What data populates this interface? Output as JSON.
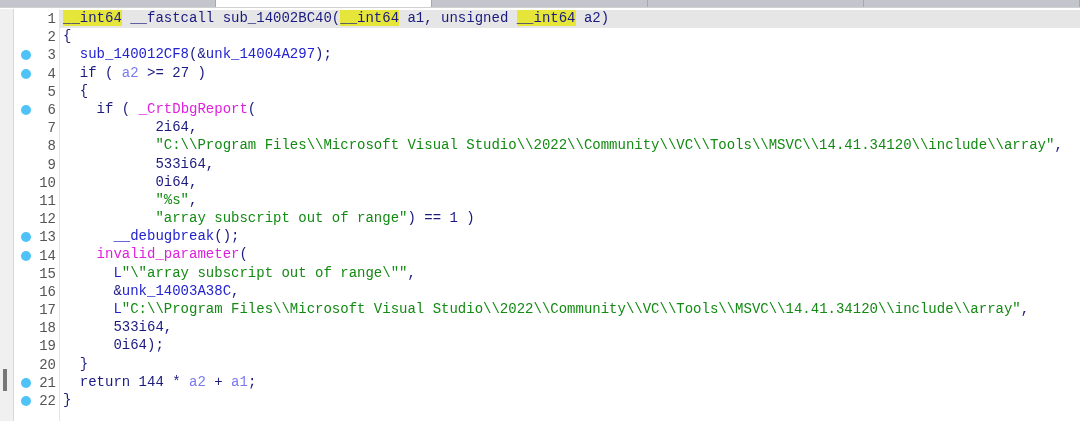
{
  "tabs": [
    {
      "selected": false
    },
    {
      "selected": true
    },
    {
      "selected": false
    },
    {
      "selected": false
    },
    {
      "selected": false
    }
  ],
  "lines": [
    {
      "number": "1",
      "breakpoint": false,
      "current": true,
      "tokens": [
        {
          "t": "__int64",
          "kind": "hl"
        },
        {
          "t": " __fastcall sub_14002BC40(",
          "kind": "plain"
        },
        {
          "t": "__int64",
          "kind": "hl"
        },
        {
          "t": " a1, unsigned ",
          "kind": "plain"
        },
        {
          "t": "__int64",
          "kind": "hl"
        },
        {
          "t": " a2)",
          "kind": "plain"
        }
      ]
    },
    {
      "number": "2",
      "breakpoint": false,
      "current": false,
      "tokens": [
        {
          "t": "{",
          "kind": "plain"
        }
      ]
    },
    {
      "number": "3",
      "breakpoint": true,
      "current": false,
      "tokens": [
        {
          "t": "  sub_140012CF8",
          "kind": "func"
        },
        {
          "t": "(&",
          "kind": "plain"
        },
        {
          "t": "unk_14004A297",
          "kind": "func"
        },
        {
          "t": ");",
          "kind": "plain"
        }
      ]
    },
    {
      "number": "4",
      "breakpoint": true,
      "current": false,
      "tokens": [
        {
          "t": "  if ( ",
          "kind": "plain"
        },
        {
          "t": "a2",
          "kind": "var"
        },
        {
          "t": " >= 27 )",
          "kind": "plain"
        }
      ]
    },
    {
      "number": "5",
      "breakpoint": false,
      "current": false,
      "tokens": [
        {
          "t": "  {",
          "kind": "plain"
        }
      ]
    },
    {
      "number": "6",
      "breakpoint": true,
      "current": false,
      "tokens": [
        {
          "t": "    if ( ",
          "kind": "plain"
        },
        {
          "t": "_CrtDbgReport",
          "kind": "lib"
        },
        {
          "t": "(",
          "kind": "plain"
        }
      ]
    },
    {
      "number": "7",
      "breakpoint": false,
      "current": false,
      "tokens": [
        {
          "t": "           2i64,",
          "kind": "plain"
        }
      ]
    },
    {
      "number": "8",
      "breakpoint": false,
      "current": false,
      "tokens": [
        {
          "t": "           \"C:\\\\Program Files\\\\Microsoft Visual Studio\\\\2022\\\\Community\\\\VC\\\\Tools\\\\MSVC\\\\14.41.34120\\\\include\\\\array\"",
          "kind": "str"
        },
        {
          "t": ",",
          "kind": "plain"
        }
      ]
    },
    {
      "number": "9",
      "breakpoint": false,
      "current": false,
      "tokens": [
        {
          "t": "           533i64,",
          "kind": "plain"
        }
      ]
    },
    {
      "number": "10",
      "breakpoint": false,
      "current": false,
      "tokens": [
        {
          "t": "           0i64,",
          "kind": "plain"
        }
      ]
    },
    {
      "number": "11",
      "breakpoint": false,
      "current": false,
      "tokens": [
        {
          "t": "           \"%s\"",
          "kind": "str"
        },
        {
          "t": ",",
          "kind": "plain"
        }
      ]
    },
    {
      "number": "12",
      "breakpoint": false,
      "current": false,
      "tokens": [
        {
          "t": "           \"array subscript out of range\"",
          "kind": "str"
        },
        {
          "t": ") == 1 )",
          "kind": "plain"
        }
      ]
    },
    {
      "number": "13",
      "breakpoint": true,
      "current": false,
      "tokens": [
        {
          "t": "      __debugbreak",
          "kind": "func"
        },
        {
          "t": "();",
          "kind": "plain"
        }
      ]
    },
    {
      "number": "14",
      "breakpoint": true,
      "current": false,
      "tokens": [
        {
          "t": "    invalid_parameter",
          "kind": "lib"
        },
        {
          "t": "(",
          "kind": "plain"
        }
      ]
    },
    {
      "number": "15",
      "breakpoint": false,
      "current": false,
      "tokens": [
        {
          "t": "      L",
          "kind": "func"
        },
        {
          "t": "\"\\\"array subscript out of range\\\"\"",
          "kind": "str"
        },
        {
          "t": ",",
          "kind": "plain"
        }
      ]
    },
    {
      "number": "16",
      "breakpoint": false,
      "current": false,
      "tokens": [
        {
          "t": "      &",
          "kind": "plain"
        },
        {
          "t": "unk_14003A38C",
          "kind": "func"
        },
        {
          "t": ",",
          "kind": "plain"
        }
      ]
    },
    {
      "number": "17",
      "breakpoint": false,
      "current": false,
      "tokens": [
        {
          "t": "      L",
          "kind": "func"
        },
        {
          "t": "\"C:\\\\Program Files\\\\Microsoft Visual Studio\\\\2022\\\\Community\\\\VC\\\\Tools\\\\MSVC\\\\14.41.34120\\\\include\\\\array\"",
          "kind": "str"
        },
        {
          "t": ",",
          "kind": "plain"
        }
      ]
    },
    {
      "number": "18",
      "breakpoint": false,
      "current": false,
      "tokens": [
        {
          "t": "      533i64,",
          "kind": "plain"
        }
      ]
    },
    {
      "number": "19",
      "breakpoint": false,
      "current": false,
      "tokens": [
        {
          "t": "      0i64);",
          "kind": "plain"
        }
      ]
    },
    {
      "number": "20",
      "breakpoint": false,
      "current": false,
      "tokens": [
        {
          "t": "  }",
          "kind": "plain"
        }
      ]
    },
    {
      "number": "21",
      "breakpoint": true,
      "current": false,
      "tokens": [
        {
          "t": "  return 144 * ",
          "kind": "plain"
        },
        {
          "t": "a2",
          "kind": "var"
        },
        {
          "t": " + ",
          "kind": "plain"
        },
        {
          "t": "a1",
          "kind": "var"
        },
        {
          "t": ";",
          "kind": "plain"
        }
      ]
    },
    {
      "number": "22",
      "breakpoint": true,
      "current": false,
      "tokens": [
        {
          "t": "}",
          "kind": "plain"
        }
      ]
    }
  ]
}
